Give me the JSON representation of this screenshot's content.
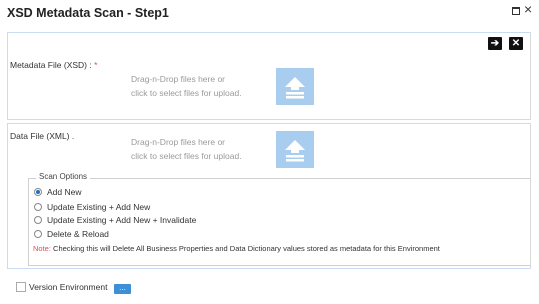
{
  "window": {
    "title": "XSD Metadata Scan - Step1"
  },
  "toolbar": {
    "next_icon": "arrow-right-icon",
    "close_icon": "close-icon"
  },
  "metadata_file": {
    "label": "Metadata File (XSD) : ",
    "required_mark": "*",
    "hint_line1": "Drag-n-Drop files here or",
    "hint_line2": "click to select files for upload."
  },
  "data_file": {
    "label": "Data File (XML) .",
    "hint_line1": "Drag-n-Drop files here or",
    "hint_line2": "click to select files for upload."
  },
  "scan_options": {
    "legend": "Scan Options",
    "options": [
      {
        "label": "Add New",
        "checked": true
      },
      {
        "label": "Update Existing + Add New",
        "checked": false
      },
      {
        "label": "Update Existing + Add New + Invalidate",
        "checked": false
      },
      {
        "label": "Delete & Reload",
        "checked": false
      }
    ],
    "note_label": "Note:",
    "note_text": " Checking this will Delete All Business Properties and Data Dictionary values stored as metadata for this Environment"
  },
  "version": {
    "label": "Version Environment",
    "button_label": "..."
  },
  "colors": {
    "upload_button": "#a9cdee",
    "accent": "#1a6fcf",
    "required": "#d9534f"
  }
}
